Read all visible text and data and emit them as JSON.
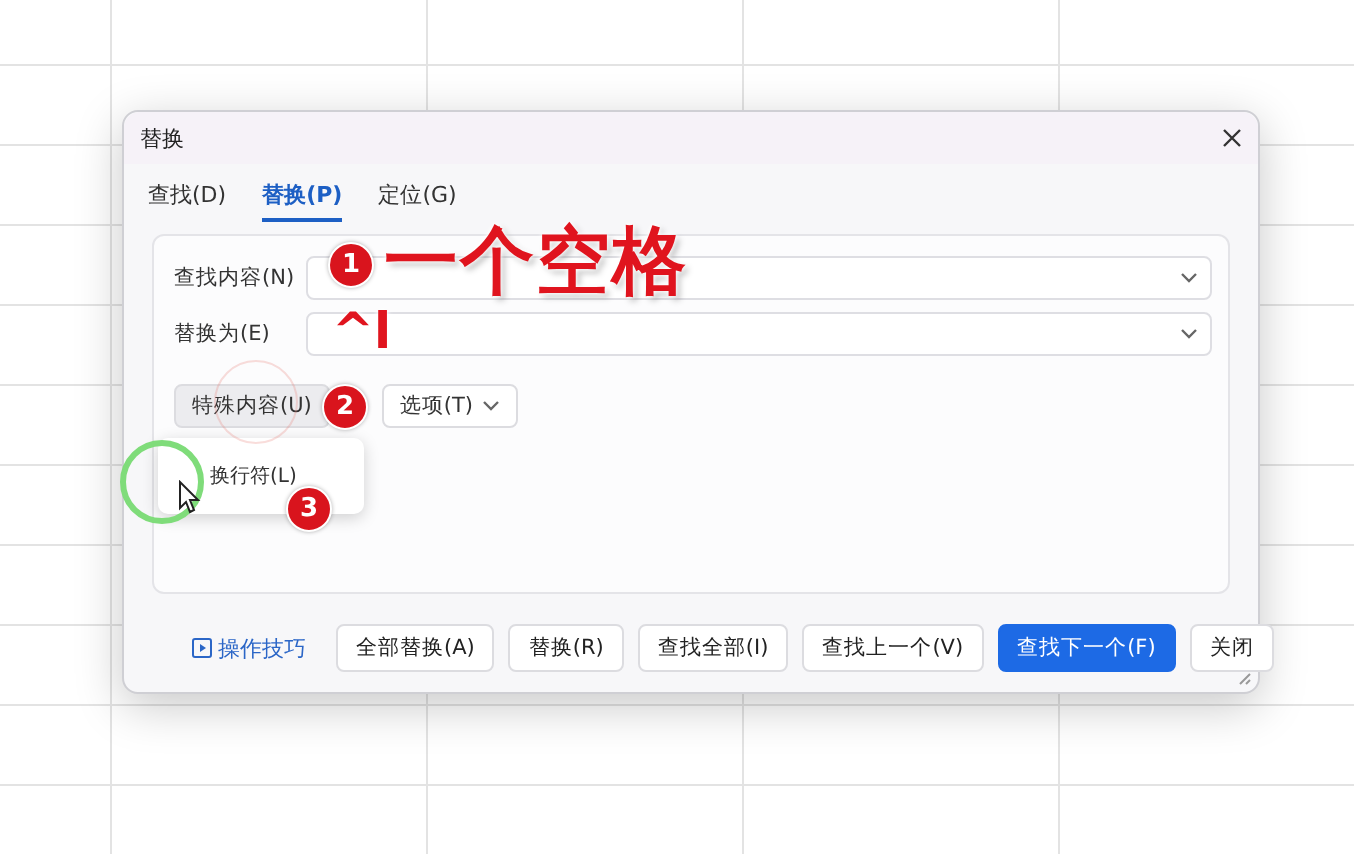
{
  "dialog": {
    "title": "替换",
    "tabs": [
      {
        "label": "查找(D)",
        "selected": false
      },
      {
        "label": "替换(P)",
        "selected": true
      },
      {
        "label": "定位(G)",
        "selected": false
      }
    ],
    "fields": [
      {
        "label": "查找内容(N)"
      },
      {
        "label": "替换为(E)"
      }
    ],
    "special_button": "特殊内容(U)",
    "options_button": "选项(T)",
    "menu": {
      "items": [
        "换行符(L)"
      ]
    },
    "tips_link": "操作技巧",
    "buttons": [
      {
        "label": "全部替换(A)",
        "primary": false
      },
      {
        "label": "替换(R)",
        "primary": false
      },
      {
        "label": "查找全部(I)",
        "primary": false
      },
      {
        "label": "查找上一个(V)",
        "primary": false
      },
      {
        "label": "查找下一个(F)",
        "primary": true
      },
      {
        "label": "关闭",
        "primary": false
      }
    ]
  },
  "annotations": {
    "markers": [
      "1",
      "2",
      "3"
    ],
    "callout": "一个空格",
    "typed": "^l"
  }
}
